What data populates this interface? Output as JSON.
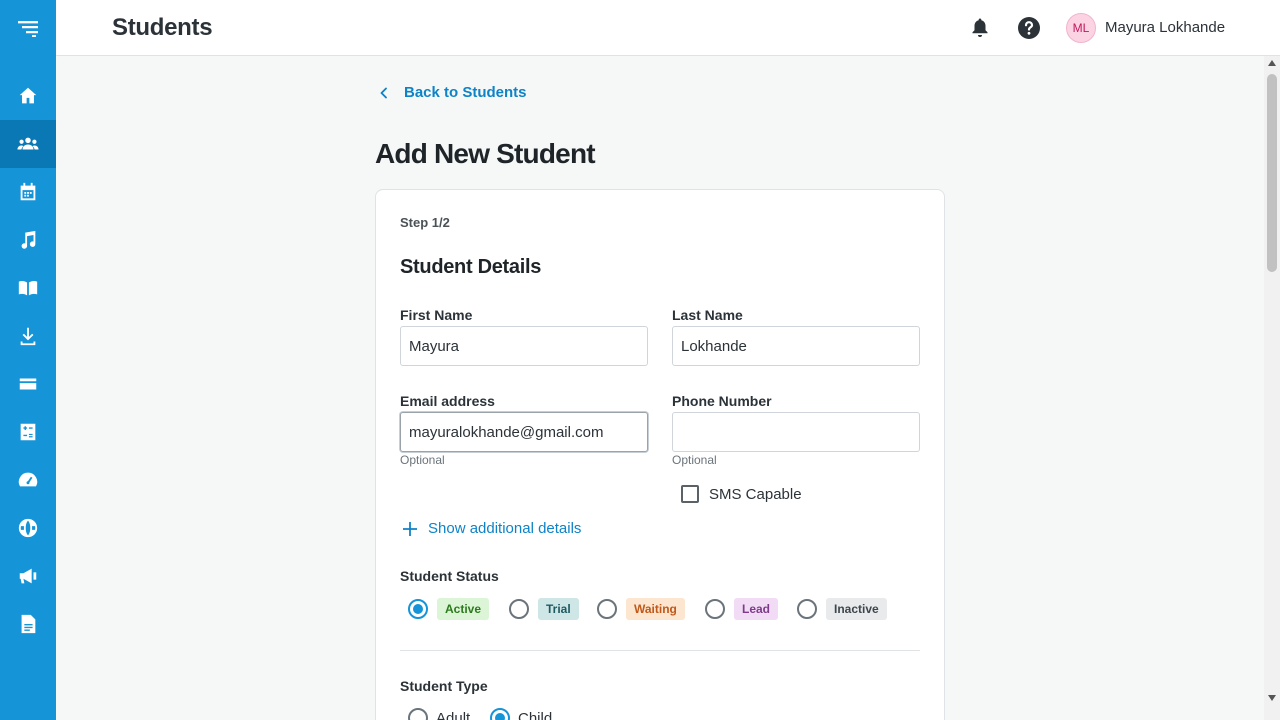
{
  "header": {
    "title": "Students",
    "user": {
      "initials": "ML",
      "name": "Mayura Lokhande"
    }
  },
  "sidebar": {
    "items": [
      {
        "name": "home",
        "icon": "home-icon",
        "active": false
      },
      {
        "name": "students",
        "icon": "people-icon",
        "active": true
      },
      {
        "name": "calendar",
        "icon": "calendar-icon",
        "active": false
      },
      {
        "name": "music",
        "icon": "music-note-icon",
        "active": false
      },
      {
        "name": "library",
        "icon": "book-icon",
        "active": false
      },
      {
        "name": "downloads",
        "icon": "download-icon",
        "active": false
      },
      {
        "name": "billing",
        "icon": "credit-card-icon",
        "active": false
      },
      {
        "name": "calculator",
        "icon": "calculator-icon",
        "active": false
      },
      {
        "name": "dashboard",
        "icon": "speedometer-icon",
        "active": false
      },
      {
        "name": "website",
        "icon": "globe-icon",
        "active": false
      },
      {
        "name": "marketing",
        "icon": "megaphone-icon",
        "active": false
      },
      {
        "name": "documents",
        "icon": "document-icon",
        "active": false
      }
    ]
  },
  "main": {
    "back_link": "Back to Students",
    "heading": "Add New Student"
  },
  "form": {
    "step": "Step 1/2",
    "section_title": "Student Details",
    "first_name": {
      "label": "First Name",
      "value": "Mayura"
    },
    "last_name": {
      "label": "Last Name",
      "value": "Lokhande"
    },
    "email": {
      "label": "Email address",
      "value": "mayuralokhande@gmail.com",
      "hint": "Optional"
    },
    "phone": {
      "label": "Phone Number",
      "value": "",
      "hint": "Optional"
    },
    "sms_capable": {
      "label": "SMS Capable",
      "checked": false
    },
    "show_details": "Show additional details",
    "status": {
      "label": "Student Status",
      "selected": "Active",
      "options": [
        "Active",
        "Trial",
        "Waiting",
        "Lead",
        "Inactive"
      ]
    },
    "type": {
      "label": "Student Type",
      "selected": "Child",
      "options": [
        "Adult",
        "Child"
      ]
    }
  },
  "colors": {
    "sidebar": "#1594d8",
    "sidebar_active": "#0b78b6",
    "link": "#0e83c7",
    "radio_checked": "#1594d8"
  }
}
